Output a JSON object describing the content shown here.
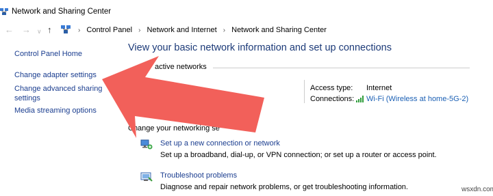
{
  "window": {
    "title": "Network and Sharing Center",
    "icon": "network-center-icon"
  },
  "address_bar": {
    "breadcrumbs": [
      "Control Panel",
      "Network and Internet",
      "Network and Sharing Center"
    ]
  },
  "left_pane": {
    "home": "Control Panel Home",
    "adapter": "Change adapter settings",
    "advanced": "Change advanced sharing settings",
    "media": "Media streaming options"
  },
  "main": {
    "heading": "View your basic network information and set up connections",
    "active_networks_label": "active networks",
    "access_type_label": "Access type:",
    "access_type_value": "Internet",
    "connections_label": "Connections:",
    "connections_value": "Wi-Fi (Wireless at home-5G-2)",
    "change_settings_label": "Change your networking se",
    "tasks": [
      {
        "icon": "network-setup-icon",
        "title": "Set up a new connection or network",
        "description": "Set up a broadband, dial-up, or VPN connection; or set up a router or access point."
      },
      {
        "icon": "troubleshoot-icon",
        "title": "Troubleshoot problems",
        "description": "Diagnose and repair network problems, or get troubleshooting information."
      }
    ]
  },
  "overlay": {
    "arrow_color": "#f2605a",
    "watermark": "wsxdn.com"
  }
}
